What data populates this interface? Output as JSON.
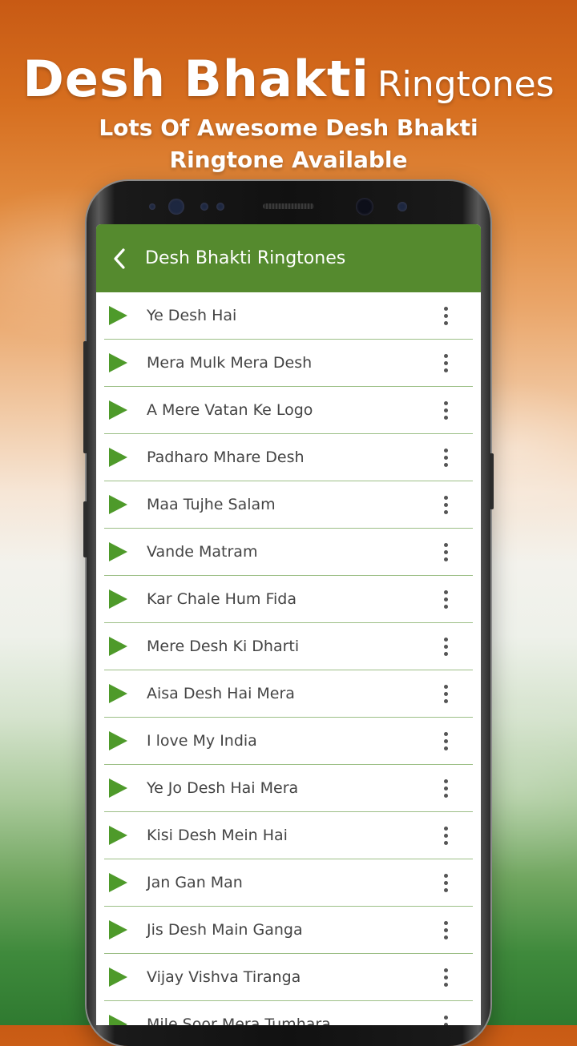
{
  "promo": {
    "title_bold": "Desh Bhakti",
    "title_light": "Ringtones",
    "tagline_line1": "Lots Of Awesome Desh Bhakti",
    "tagline_line2": "Ringtone Available"
  },
  "appbar": {
    "title": "Desh Bhakti Ringtones",
    "color": "#558a2e"
  },
  "icons": {
    "back": "chevron-left-icon",
    "play": "play-icon",
    "more": "more-vertical-icon"
  },
  "ringtones": [
    {
      "title": "Ye Desh Hai"
    },
    {
      "title": "Mera Mulk Mera Desh"
    },
    {
      "title": "A Mere Vatan Ke Logo"
    },
    {
      "title": "Padharo Mhare Desh"
    },
    {
      "title": "Maa Tujhe Salam"
    },
    {
      "title": "Vande Matram"
    },
    {
      "title": "Kar Chale Hum Fida"
    },
    {
      "title": "Mere Desh Ki Dharti"
    },
    {
      "title": "Aisa Desh Hai Mera"
    },
    {
      "title": "I  love My India"
    },
    {
      "title": "Ye Jo Desh Hai Mera"
    },
    {
      "title": "Kisi Desh Mein Hai"
    },
    {
      "title": "Jan Gan Man"
    },
    {
      "title": "Jis Desh Main Ganga"
    },
    {
      "title": "Vijay Vishva Tiranga"
    },
    {
      "title": "Mile Soor Mera Tumhara"
    }
  ]
}
